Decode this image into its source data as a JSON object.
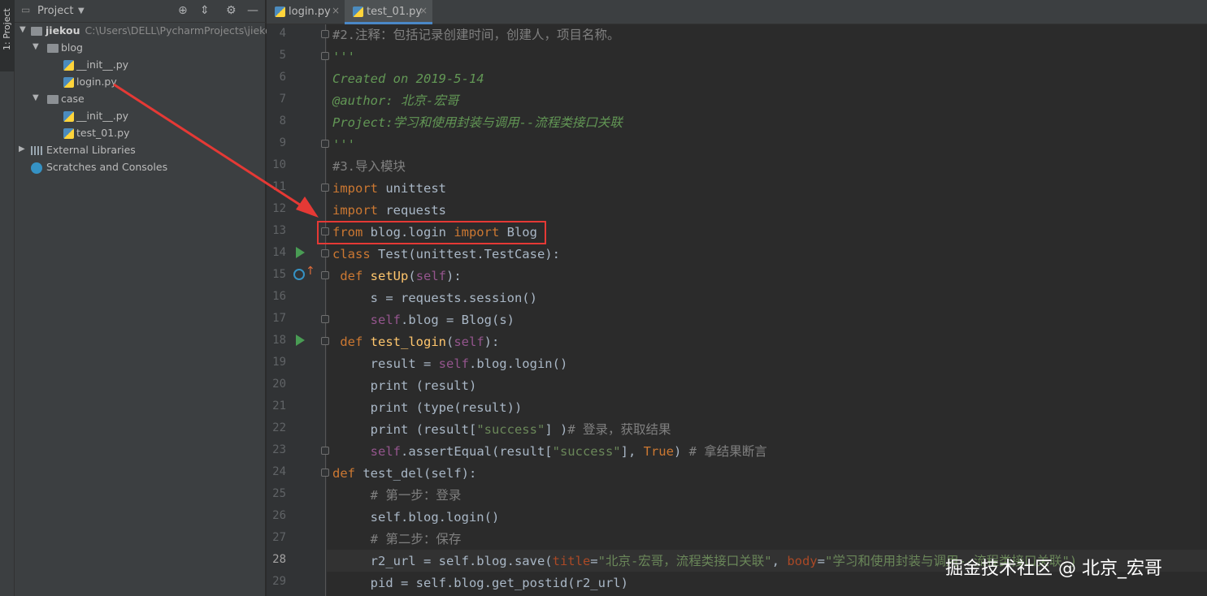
{
  "sidebar_stripe": {
    "label": "1: Project"
  },
  "project_panel": {
    "title": "Project",
    "tree": [
      {
        "label": "jiekou",
        "path": "C:\\Users\\DELL\\PycharmProjects\\jiekou"
      },
      {
        "label": "blog"
      },
      {
        "label": "__init__.py"
      },
      {
        "label": "login.py"
      },
      {
        "label": "case"
      },
      {
        "label": "__init__.py"
      },
      {
        "label": "test_01.py"
      },
      {
        "label": "External Libraries"
      },
      {
        "label": "Scratches and Consoles"
      }
    ]
  },
  "tabs": [
    {
      "label": "login.py",
      "active": false
    },
    {
      "label": "test_01.py",
      "active": true
    }
  ],
  "editor": {
    "current_line": "28",
    "line_numbers": [
      "4",
      "5",
      "6",
      "7",
      "8",
      "9",
      "10",
      "11",
      "12",
      "13",
      "14",
      "15",
      "16",
      "17",
      "18",
      "19",
      "20",
      "21",
      "22",
      "23",
      "24",
      "25",
      "26",
      "27",
      "28",
      "29"
    ],
    "lines": [
      [
        "#2.注释：包括记录创建时间，创建人，项目名称。"
      ],
      [
        "'''"
      ],
      [
        "Created on 2019-5-14"
      ],
      [
        "@author: 北京-宏哥"
      ],
      [
        "Project:学习和使用封装与调用--流程类接口关联"
      ],
      [
        "'''"
      ],
      [
        "#3.导入模块"
      ],
      [
        "import",
        " unittest"
      ],
      [
        "import",
        " requests"
      ],
      [
        "from",
        " blog.login ",
        "import",
        " Blog"
      ],
      [
        "class",
        " Test(unittest.TestCase):"
      ],
      [
        " def",
        " ",
        "setUp",
        "(",
        "self",
        "):"
      ],
      [
        "     s = requests.session()"
      ],
      [
        "     ",
        "self",
        ".blog = Blog(s)"
      ],
      [
        " def",
        " ",
        "test_login",
        "(",
        "self",
        "):"
      ],
      [
        "     result = ",
        "self",
        ".blog.login()"
      ],
      [
        "     print (result)"
      ],
      [
        "     print (type(result))"
      ],
      [
        "     print (result[",
        "\"success\"",
        "] )",
        "# 登录，获取结果"
      ],
      [
        "     ",
        "self",
        ".assertEqual(result[",
        "\"success\"",
        "], ",
        "True",
        ") ",
        "# 拿结果断言"
      ],
      [
        "def",
        " test_del(self):"
      ],
      [
        "     ",
        "# 第一步：登录"
      ],
      [
        "     self.blog.login()"
      ],
      [
        "     ",
        "# 第二步：保存"
      ],
      [
        "     r2_url = self.blog.save(",
        "title",
        "=",
        "\"北京-宏哥，流程类接口关联\"",
        ", ",
        "body",
        "=",
        "\"学习和使用封装与调用--流程类接口关联\")"
      ],
      [
        "     pid = self.blog.get_postid(r2_url)"
      ]
    ]
  },
  "watermark": "掘金技术社区 @ 北京_宏哥",
  "colors": {
    "keyword": "#cc7832",
    "text": "#a9b7c6",
    "function": "#ffc66d",
    "self": "#94558d",
    "string": "#6a8759",
    "docstring": "#629755",
    "comment": "#808080",
    "annotation": "#e53935"
  },
  "icons": [
    "target-icon",
    "collapse-icon",
    "gear-icon",
    "hide-icon",
    "run-icon",
    "override-icon",
    "folder-icon",
    "python-file-icon"
  ]
}
